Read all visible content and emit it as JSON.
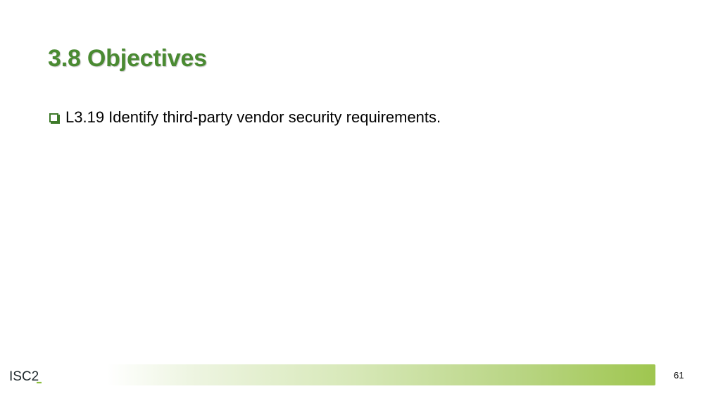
{
  "slide": {
    "title": "3.8 Objectives",
    "objectives": [
      {
        "text": "L3.19 Identify third-party vendor security requirements."
      }
    ],
    "page_number": "61"
  },
  "footer": {
    "logo_text": "ISC2",
    "logo_icon": "isc2-logo-icon"
  },
  "colors": {
    "title": "#4a8a32",
    "bullet": "#3e7a2a",
    "bar_end": "#9fc64f",
    "logo_accent": "#8cbf3f"
  }
}
